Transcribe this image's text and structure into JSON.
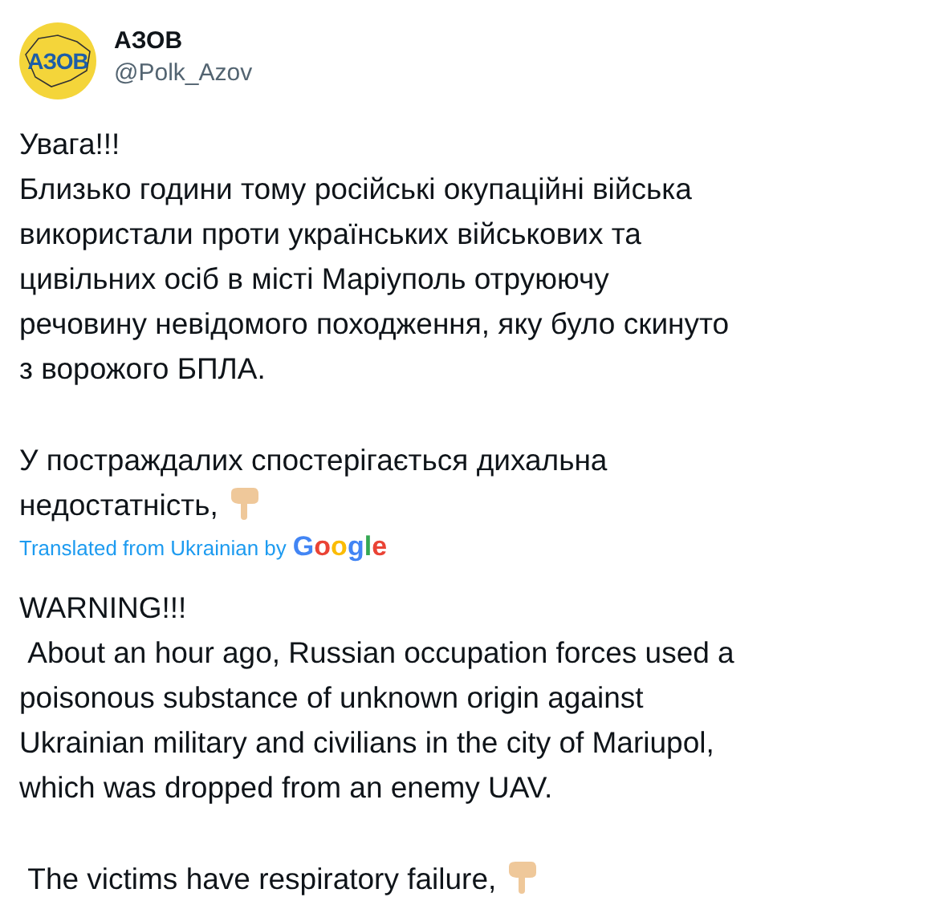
{
  "author": {
    "avatar_text": "АЗОВ",
    "name": "АЗОВ",
    "handle": "@Polk_Azov"
  },
  "original": [
    {
      "text": "Увага!!!\nБлизько години тому російські окупаційні війська\nвикористали проти українських військових та\nцивільних осіб в місті Маріуполь отруюючу\nречовину невідомого походження, яку було скинуто\nз ворожого БПЛА.",
      "emoji": false
    },
    {
      "text": "У постраждалих спостерігається дихальна\nнедостатність,",
      "emoji": true
    }
  ],
  "translation_note": {
    "label": "Translated from Ukrainian by",
    "brand": "Google"
  },
  "translation": [
    {
      "text": "WARNING!!!\n About an hour ago, Russian occupation forces used a\npoisonous substance of unknown origin against\nUkrainian military and civilians in the city of Mariupol,\nwhich was dropped from an enemy UAV.",
      "emoji": false
    },
    {
      "text": " The victims have respiratory failure,",
      "emoji": true
    }
  ]
}
